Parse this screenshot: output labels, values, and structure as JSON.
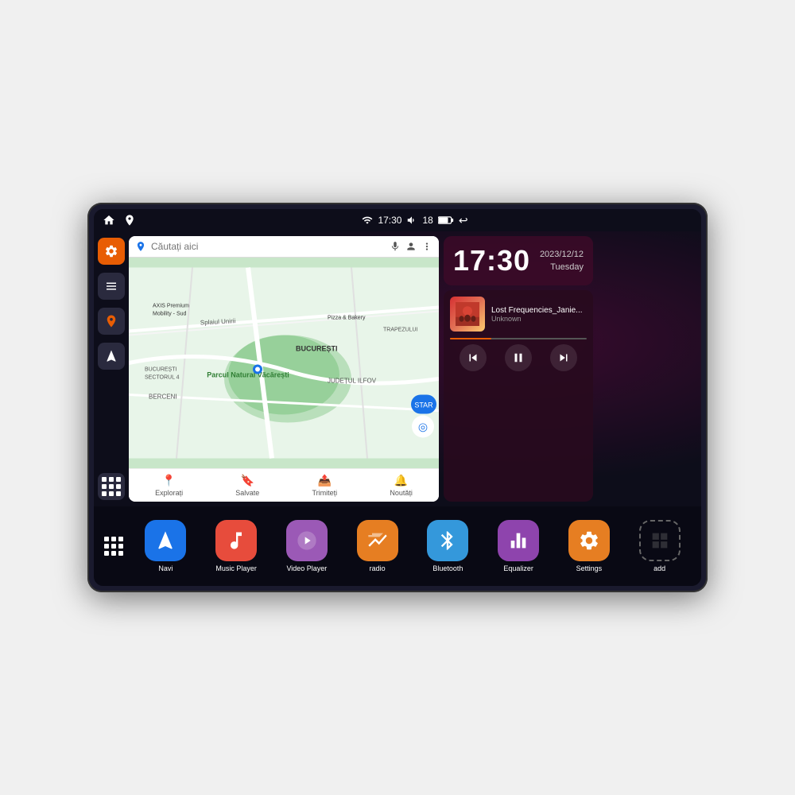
{
  "statusBar": {
    "time": "17:30",
    "battery": "18",
    "backIcon": "↩",
    "homeIcon": "⌂",
    "mapsIcon": "📍"
  },
  "map": {
    "searchPlaceholder": "Căutați aici",
    "locationLabel": "Parcul Natural Văcărești",
    "area1": "BUCUREȘTI",
    "area2": "JUDEȚUL ILFOV",
    "area3": "BERCENI",
    "area4": "BUCUREȘTI SECTORUL 4",
    "place1": "AXIS Premium Mobility - Sud",
    "place2": "Pizza & Bakery",
    "road1": "Splaiul Unirii",
    "bottomNav": [
      {
        "icon": "📍",
        "label": "Explorați"
      },
      {
        "icon": "🔖",
        "label": "Salvate"
      },
      {
        "icon": "📤",
        "label": "Trimiteți"
      },
      {
        "icon": "🔔",
        "label": "Noutăți"
      }
    ]
  },
  "clock": {
    "time": "17:30",
    "date": "2023/12/12",
    "day": "Tuesday"
  },
  "music": {
    "title": "Lost Frequencies_Janie...",
    "artist": "Unknown",
    "progress": 30
  },
  "apps": [
    {
      "id": "navi",
      "label": "Navi",
      "color": "app-navi",
      "icon": "▲"
    },
    {
      "id": "music-player",
      "label": "Music Player",
      "color": "app-music",
      "icon": "🎵"
    },
    {
      "id": "video-player",
      "label": "Video Player",
      "color": "app-video",
      "icon": "▶"
    },
    {
      "id": "radio",
      "label": "radio",
      "color": "app-radio",
      "icon": "📻"
    },
    {
      "id": "bluetooth",
      "label": "Bluetooth",
      "color": "app-bt",
      "icon": "⚡"
    },
    {
      "id": "equalizer",
      "label": "Equalizer",
      "color": "app-eq",
      "icon": "🎚"
    },
    {
      "id": "settings",
      "label": "Settings",
      "color": "app-settings",
      "icon": "⚙"
    },
    {
      "id": "add",
      "label": "add",
      "color": "app-add",
      "icon": ""
    }
  ]
}
